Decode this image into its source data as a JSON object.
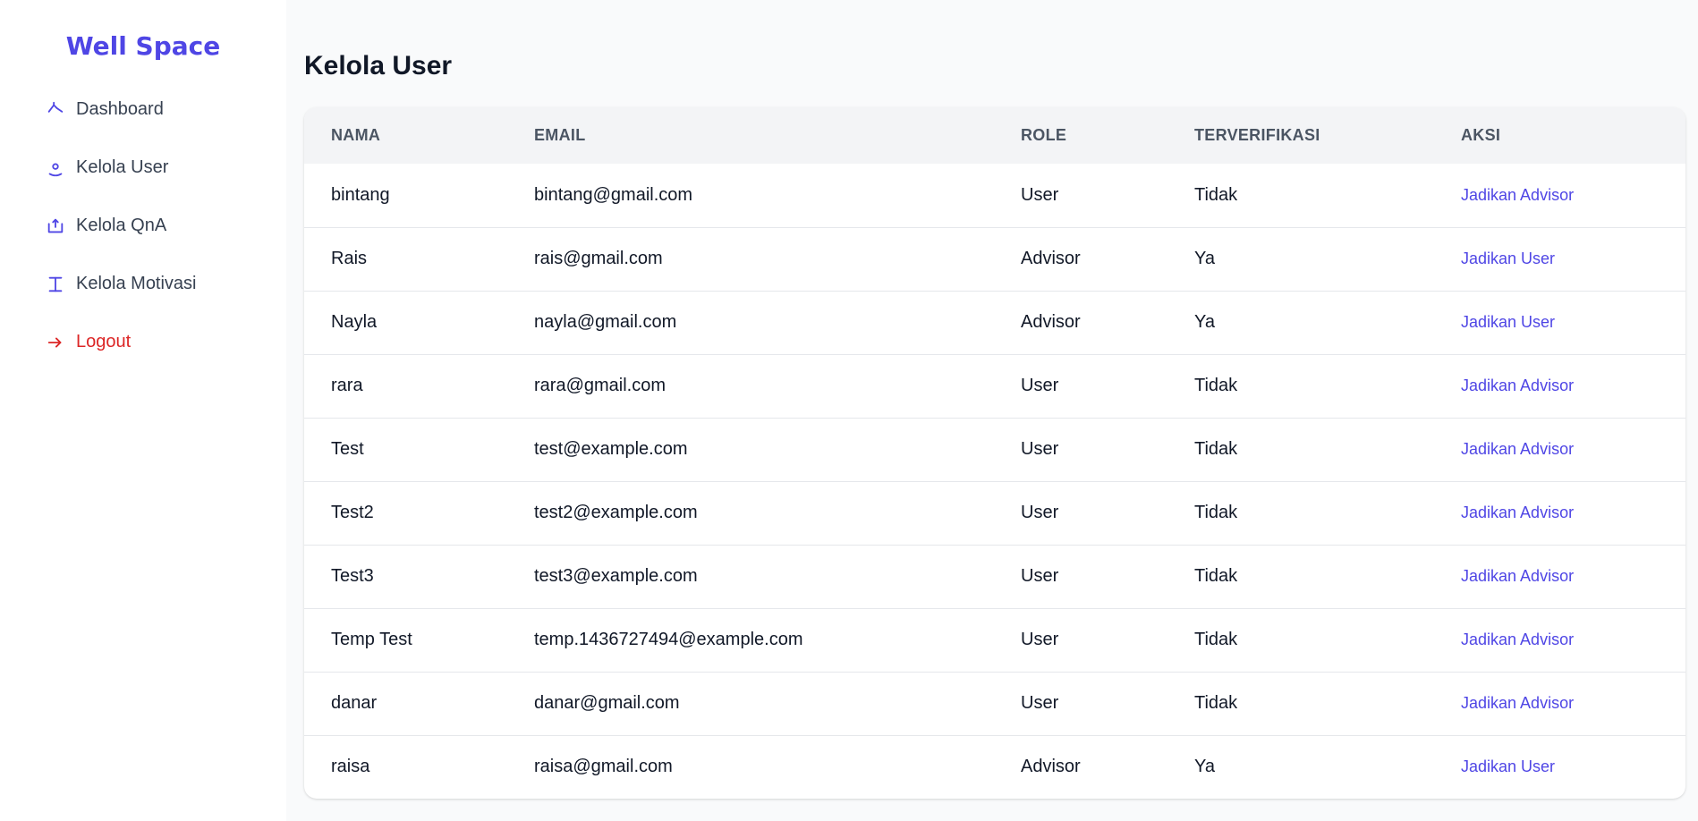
{
  "brand": {
    "name": "Well Space",
    "color": "#4f46e5"
  },
  "sidebar": {
    "items": [
      {
        "label": "Dashboard",
        "icon": "dashboard-icon"
      },
      {
        "label": "Kelola User",
        "icon": "user-icon"
      },
      {
        "label": "Kelola QnA",
        "icon": "qna-icon"
      },
      {
        "label": "Kelola Motivasi",
        "icon": "motivation-icon"
      },
      {
        "label": "Logout",
        "icon": "logout-icon",
        "color": "#dc2626"
      }
    ]
  },
  "main": {
    "title": "Kelola User",
    "table": {
      "headers": [
        "NAMA",
        "EMAIL",
        "ROLE",
        "TERVERIFIKASI",
        "AKSI"
      ],
      "rows": [
        {
          "nama": "bintang",
          "email": "bintang@gmail.com",
          "role": "User",
          "verified": "Tidak",
          "action": "Jadikan Advisor"
        },
        {
          "nama": "Rais",
          "email": "rais@gmail.com",
          "role": "Advisor",
          "verified": "Ya",
          "action": "Jadikan User"
        },
        {
          "nama": "Nayla",
          "email": "nayla@gmail.com",
          "role": "Advisor",
          "verified": "Ya",
          "action": "Jadikan User"
        },
        {
          "nama": "rara",
          "email": "rara@gmail.com",
          "role": "User",
          "verified": "Tidak",
          "action": "Jadikan Advisor"
        },
        {
          "nama": "Test",
          "email": "test@example.com",
          "role": "User",
          "verified": "Tidak",
          "action": "Jadikan Advisor"
        },
        {
          "nama": "Test2",
          "email": "test2@example.com",
          "role": "User",
          "verified": "Tidak",
          "action": "Jadikan Advisor"
        },
        {
          "nama": "Test3",
          "email": "test3@example.com",
          "role": "User",
          "verified": "Tidak",
          "action": "Jadikan Advisor"
        },
        {
          "nama": "Temp Test",
          "email": "temp.1436727494@example.com",
          "role": "User",
          "verified": "Tidak",
          "action": "Jadikan Advisor"
        },
        {
          "nama": "danar",
          "email": "danar@gmail.com",
          "role": "User",
          "verified": "Tidak",
          "action": "Jadikan Advisor"
        },
        {
          "nama": "raisa",
          "email": "raisa@gmail.com",
          "role": "Advisor",
          "verified": "Ya",
          "action": "Jadikan User"
        }
      ]
    }
  }
}
